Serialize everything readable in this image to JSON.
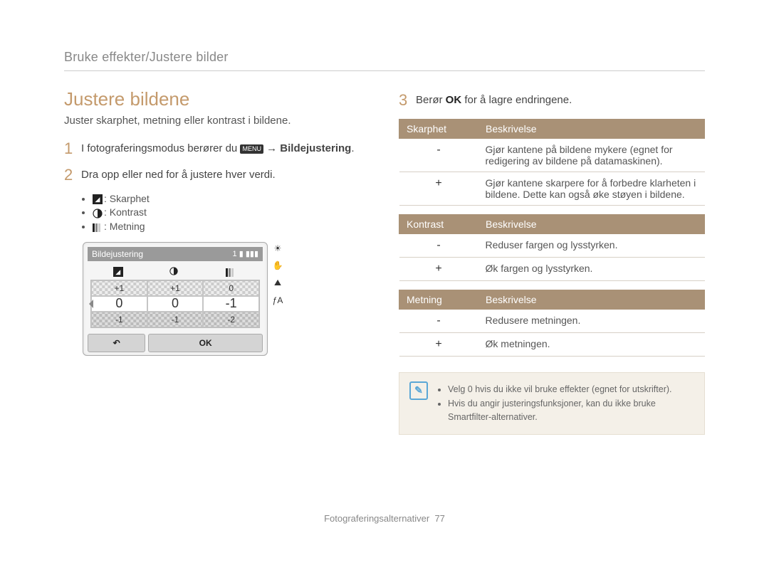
{
  "breadcrumb": "Bruke effekter/Justere bilder",
  "section_title": "Justere bildene",
  "subtitle": "Juster skarphet, metning eller kontrast i bildene.",
  "steps": {
    "s1": {
      "num": "1",
      "text_a": "I fotograferingsmodus berører du ",
      "menu": "MENU",
      "arrow": " → ",
      "target": "Bildejustering",
      "text_b": "."
    },
    "s2": {
      "num": "2",
      "text": "Dra opp eller ned for å justere hver verdi."
    },
    "s3": {
      "num": "3",
      "text_a": "Berør ",
      "ok": "OK",
      "text_b": " for å lagre endringene."
    }
  },
  "legend": {
    "sharp": "Skarphet",
    "contrast": "Kontrast",
    "sat": "Metning"
  },
  "screen": {
    "title": "Bildejustering",
    "count": "1",
    "row_plus": [
      "+1",
      "+1",
      "0"
    ],
    "row_sel": [
      "0",
      "0",
      "-1"
    ],
    "row_minus": [
      "-1",
      "-1",
      "-2"
    ],
    "back": "↶",
    "ok": "OK"
  },
  "side_icons": [
    "☀",
    "✋",
    "⛰",
    "ƒA"
  ],
  "tables": {
    "sharp": {
      "h1": "Skarphet",
      "h2": "Beskrivelse",
      "rows": [
        {
          "sym": "-",
          "desc": "Gjør kantene på bildene mykere (egnet for redigering av bildene på datamaskinen)."
        },
        {
          "sym": "+",
          "desc": "Gjør kantene skarpere for å forbedre klarheten i bildene. Dette kan også øke støyen i bildene."
        }
      ]
    },
    "contrast": {
      "h1": "Kontrast",
      "h2": "Beskrivelse",
      "rows": [
        {
          "sym": "-",
          "desc": "Reduser fargen og lysstyrken."
        },
        {
          "sym": "+",
          "desc": "Øk fargen og lysstyrken."
        }
      ]
    },
    "sat": {
      "h1": "Metning",
      "h2": "Beskrivelse",
      "rows": [
        {
          "sym": "-",
          "desc": "Redusere metningen."
        },
        {
          "sym": "+",
          "desc": "Øk metningen."
        }
      ]
    }
  },
  "notes": [
    "Velg 0 hvis du ikke vil bruke effekter (egnet for utskrifter).",
    "Hvis du angir justeringsfunksjoner, kan du ikke bruke Smartfilter-alternativer."
  ],
  "footer": {
    "text": "Fotograferingsalternativer",
    "page": "77"
  }
}
